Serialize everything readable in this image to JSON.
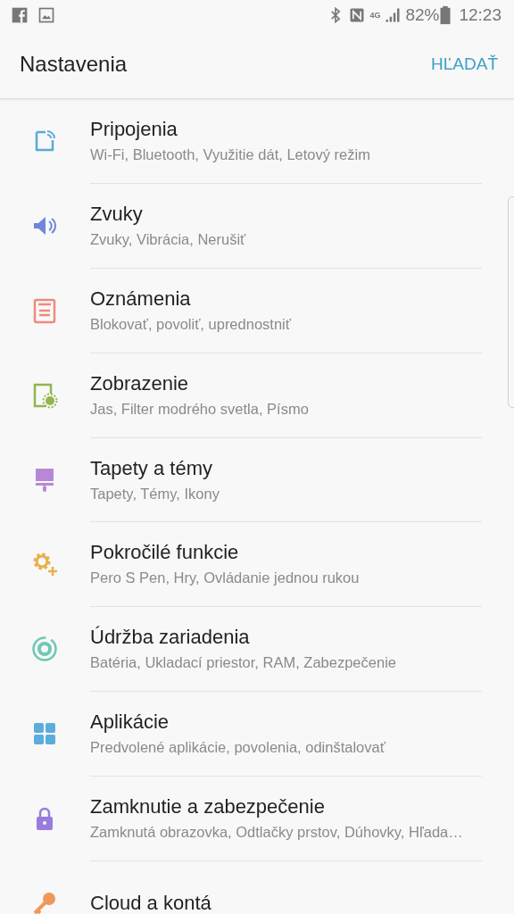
{
  "status_bar": {
    "network": "4G",
    "battery": "82%",
    "time": "12:23"
  },
  "header": {
    "title": "Nastavenia",
    "action": "HĽADAŤ"
  },
  "items": [
    {
      "title": "Pripojenia",
      "subtitle": "Wi-Fi, Bluetooth, Využitie dát, Letový režim",
      "color": "#5aa9d6"
    },
    {
      "title": "Zvuky",
      "subtitle": "Zvuky, Vibrácia, Nerušiť",
      "color": "#6f86d9"
    },
    {
      "title": "Oznámenia",
      "subtitle": "Blokovať, povoliť, uprednostniť",
      "color": "#ee8a7c"
    },
    {
      "title": "Zobrazenie",
      "subtitle": "Jas, Filter modrého svetla, Písmo",
      "color": "#92b550"
    },
    {
      "title": "Tapety a témy",
      "subtitle": "Tapety, Témy, Ikony",
      "color": "#b888d6"
    },
    {
      "title": "Pokročilé funkcie",
      "subtitle": "Pero S Pen, Hry, Ovládanie jednou rukou",
      "color": "#e8b04a"
    },
    {
      "title": "Údržba zariadenia",
      "subtitle": "Batéria, Ukladací priestor, RAM, Zabezpečenie",
      "color": "#6ec8b4"
    },
    {
      "title": "Aplikácie",
      "subtitle": "Predvolené aplikácie, povolenia, odinštalovať",
      "color": "#5aaedb"
    },
    {
      "title": "Zamknutie a zabezpečenie",
      "subtitle": "Zamknutá obrazovka, Odtlačky prstov, Dúhovky, Hľada…",
      "color": "#9a7be0"
    },
    {
      "title": "Cloud a kontá",
      "color": "#f0975a"
    }
  ]
}
